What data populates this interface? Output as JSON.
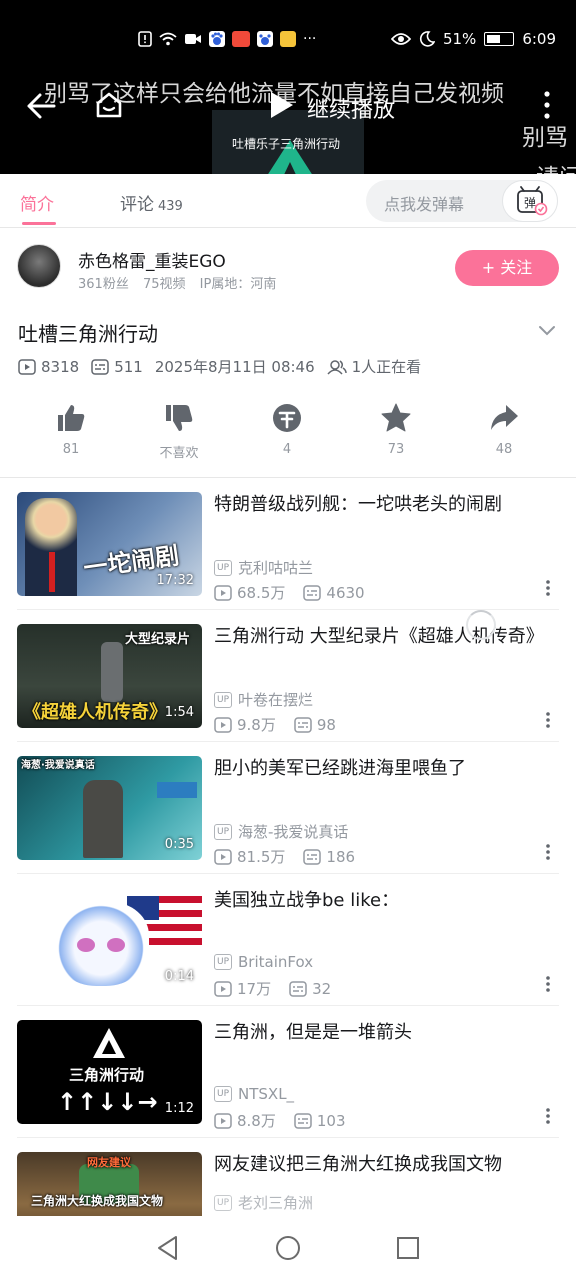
{
  "statusbar": {
    "battery": "51%",
    "time": "6:09",
    "icons": [
      "alert-icon",
      "wifi-icon",
      "video-call-icon",
      "baidu-icon",
      "app-red-icon",
      "baidu-icon",
      "app-yellow-icon",
      "more-dots-icon",
      "eye-icon",
      "moon-icon",
      "battery-icon"
    ],
    "more": "···"
  },
  "player": {
    "danmaku": [
      "别骂了这样只会给他流量不如直接自己发视频",
      "别骂",
      "请问"
    ],
    "resume_label": "继续播放",
    "video_subtitle": "吐槽乐子三角洲行动"
  },
  "tabs": {
    "intro": "简介",
    "comments": "评论",
    "comments_count": "439",
    "danmaku_placeholder": "点我发弹幕",
    "danmaku_toggle": "弹"
  },
  "uploader": {
    "name": "赤色格雷_重装EGO",
    "fans": "361粉丝",
    "videos": "75视频",
    "ip": "IP属地：河南",
    "follow": "+ 关注"
  },
  "video": {
    "title": "吐槽三角洲行动",
    "plays": "8318",
    "danmaku": "511",
    "date": "2025年8月11日 08:46",
    "watching": "1人正在看"
  },
  "actions": {
    "like": "81",
    "dislike": "不喜欢",
    "coin": "4",
    "favorite": "73",
    "share": "48"
  },
  "related": [
    {
      "title": "特朗普级战列舰：一坨哄老头的闹剧",
      "uploader": "克利咕咕兰",
      "plays": "68.5万",
      "danmaku": "4630",
      "duration": "17:32",
      "thumb_text": "一坨闹剧",
      "colors": [
        "#3a5a8c",
        "#9db4d0"
      ]
    },
    {
      "title": "三角洲行动 大型纪录片《超雄人机传奇》",
      "uploader": "叶卷在摆烂",
      "plays": "9.8万",
      "danmaku": "98",
      "duration": "1:54",
      "thumb_text": "《超雄人机传奇》",
      "thumb_text2": "大型纪录片",
      "colors": [
        "#1e2a22",
        "#4a5a44"
      ]
    },
    {
      "title": "胆小的美军已经跳进海里喂鱼了",
      "uploader": "海葱-我爱说真话",
      "plays": "81.5万",
      "danmaku": "186",
      "duration": "0:35",
      "thumb_text": "海葱·我爱说真话",
      "colors": [
        "#1f6f78",
        "#3fb0b8"
      ]
    },
    {
      "title": "美国独立战争be like：",
      "uploader": "BritainFox",
      "plays": "17万",
      "danmaku": "32",
      "duration": "0:14",
      "thumb_text": "",
      "colors": [
        "#ffffff",
        "#e8eefc"
      ]
    },
    {
      "title": "三角洲，但是是一堆箭头",
      "uploader": "NTSXL_",
      "plays": "8.8万",
      "danmaku": "103",
      "duration": "1:12",
      "thumb_text": "三角洲行动",
      "thumb_text2": "↑↑↓↓→",
      "colors": [
        "#000000",
        "#111111"
      ]
    },
    {
      "title": "网友建议把三角洲大红换成我国文物",
      "uploader": "老刘三角洲",
      "plays": "",
      "danmaku": "",
      "duration": "",
      "thumb_text": "三角洲大红换成我国文物",
      "thumb_text2": "网友建议",
      "colors": [
        "#6b4a2a",
        "#c08850"
      ]
    }
  ],
  "navbar": {
    "icons": [
      "back-triangle-icon",
      "home-circle-icon",
      "recents-square-icon"
    ]
  },
  "theme": {
    "accent": "#fb7299",
    "text_secondary": "#9499a0"
  }
}
